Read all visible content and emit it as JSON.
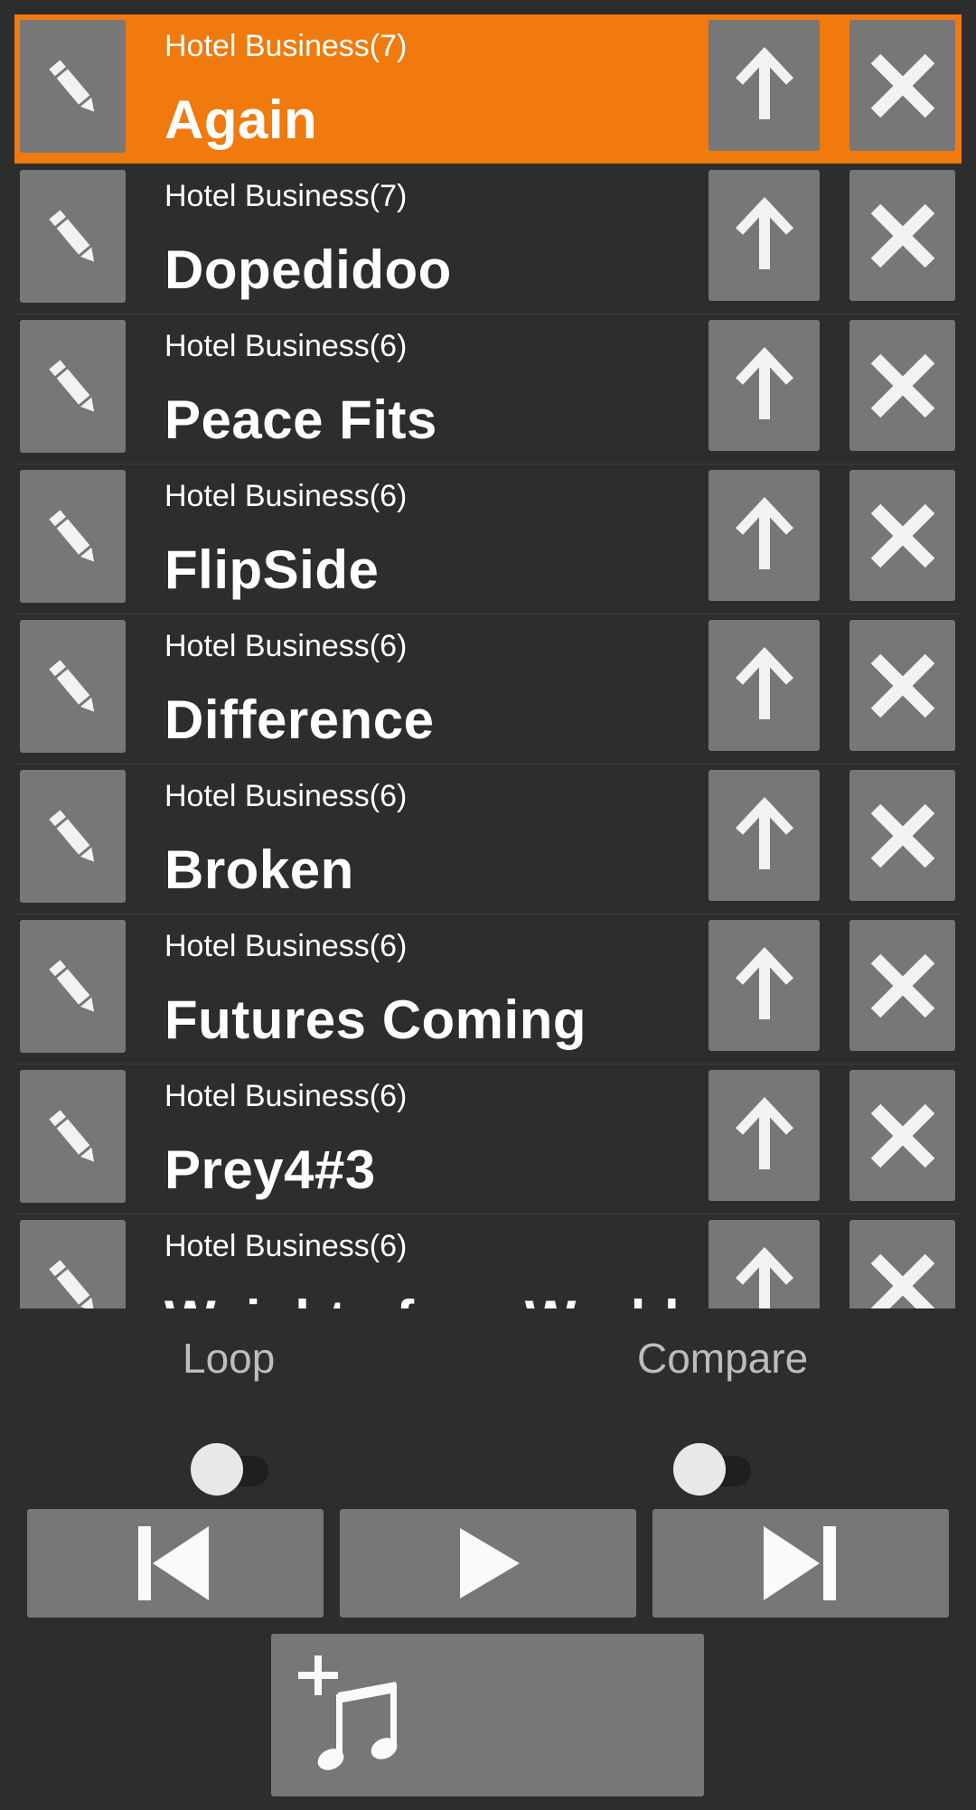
{
  "tracks": [
    {
      "album": "Hotel Business(7)",
      "title": "Again",
      "selected": true
    },
    {
      "album": "Hotel Business(7)",
      "title": "Dopedidoo"
    },
    {
      "album": "Hotel Business(6)",
      "title": "Peace Fits"
    },
    {
      "album": "Hotel Business(6)",
      "title": "FlipSide"
    },
    {
      "album": "Hotel Business(6)",
      "title": "Difference"
    },
    {
      "album": "Hotel Business(6)",
      "title": "Broken"
    },
    {
      "album": "Hotel Business(6)",
      "title": "Futures Coming"
    },
    {
      "album": "Hotel Business(6)",
      "title": "Prey4#3"
    },
    {
      "album": "Hotel Business(6)",
      "title": "Weight of my World"
    }
  ],
  "controls": {
    "loop_label": "Loop",
    "compare_label": "Compare",
    "loop_on": false,
    "compare_on": false
  },
  "icons": {
    "edit": "pencil-icon",
    "move_up": "arrow-up-icon",
    "remove": "close-icon",
    "previous": "skip-previous-icon",
    "play": "play-icon",
    "next": "skip-next-icon",
    "add_music": "add-music-icon"
  },
  "colors": {
    "selected_row": "#f07a0e",
    "background": "#2d2d2d",
    "button": "#777777"
  }
}
